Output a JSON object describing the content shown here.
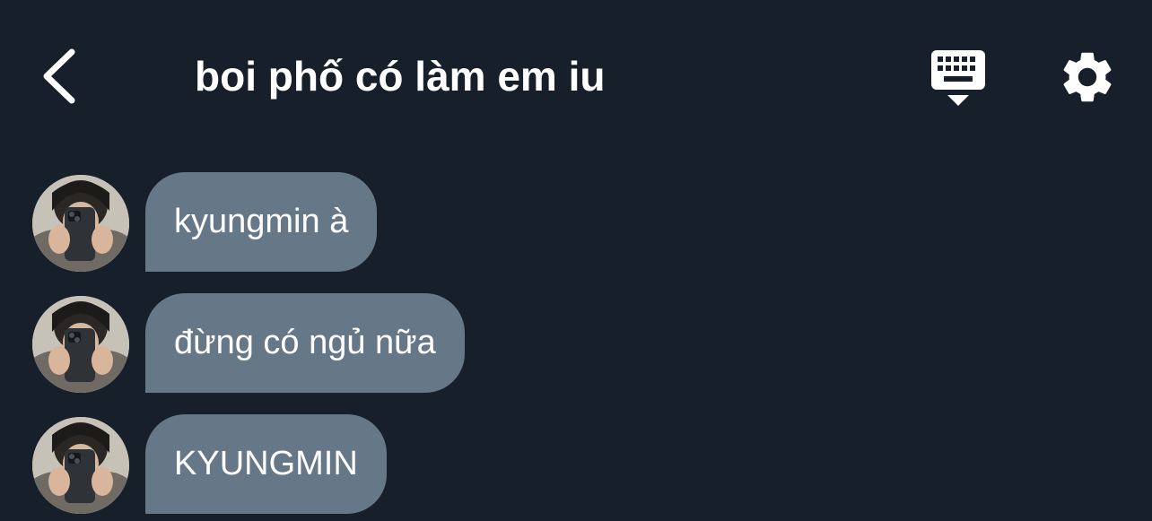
{
  "header": {
    "title": "boi phố có làm em iu",
    "back_icon": "chevron-left-icon",
    "keyboard_icon": "keyboard-hide-icon",
    "settings_icon": "gear-icon"
  },
  "messages": [
    {
      "text": "kyungmin à"
    },
    {
      "text": "đừng có ngủ nữa"
    },
    {
      "text": "KYUNGMIN"
    }
  ],
  "colors": {
    "background": "#17202a",
    "bubble": "#667788",
    "text": "#ffffff"
  }
}
